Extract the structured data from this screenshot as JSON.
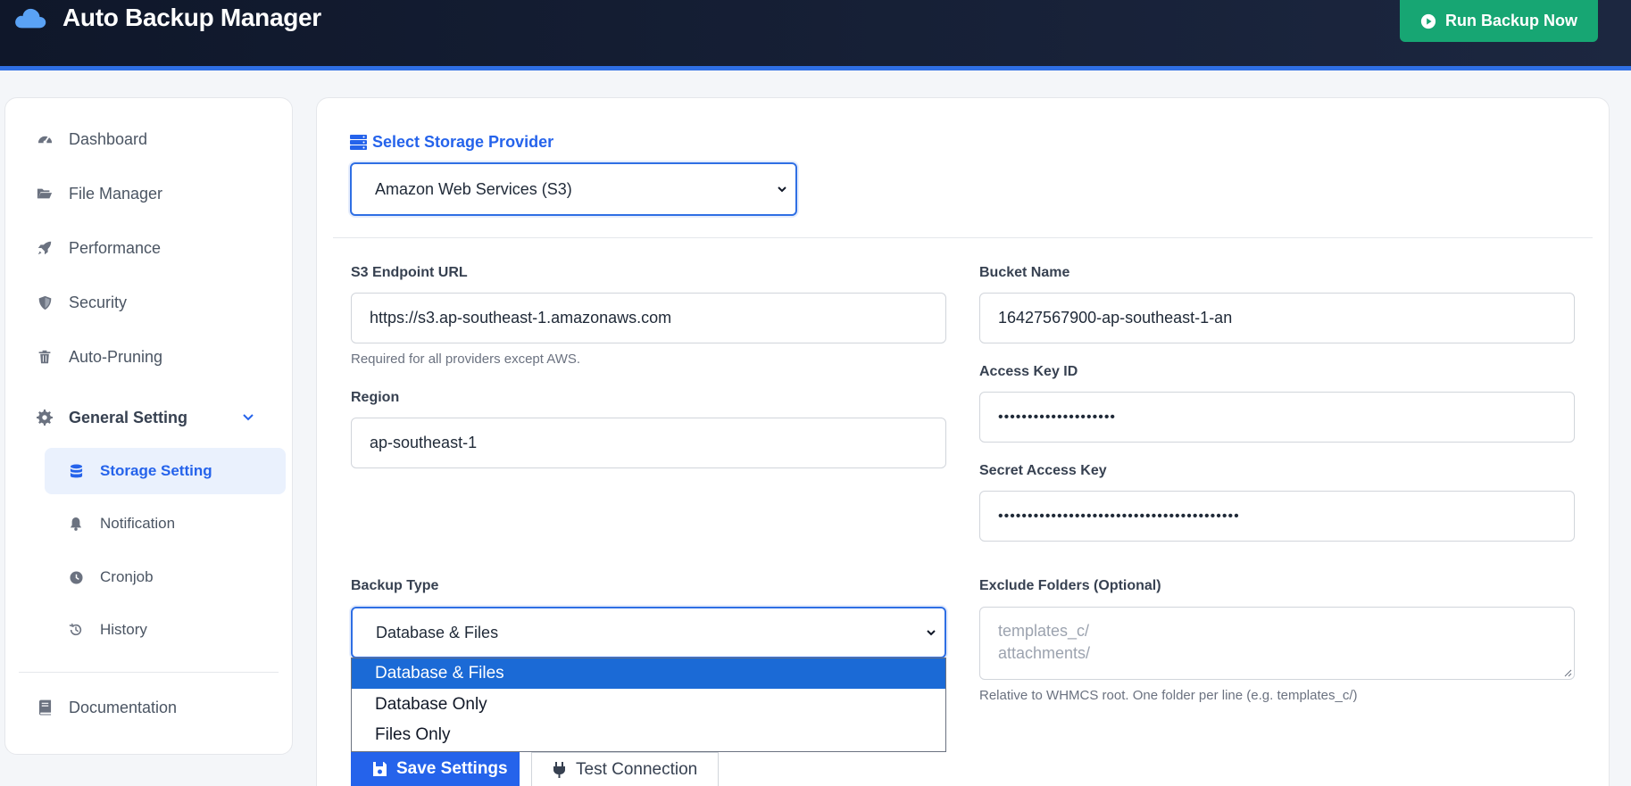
{
  "header": {
    "title": "Auto Backup Manager",
    "run_button": "Run Backup Now",
    "logo_icon": "cloud-icon"
  },
  "sidebar": {
    "items": [
      {
        "label": "Dashboard",
        "icon": "gauge-icon"
      },
      {
        "label": "File Manager",
        "icon": "folder-open-icon"
      },
      {
        "label": "Performance",
        "icon": "rocket-icon"
      },
      {
        "label": "Security",
        "icon": "shield-icon"
      },
      {
        "label": "Auto-Pruning",
        "icon": "trash-icon"
      },
      {
        "label": "General Setting",
        "icon": "gear-icon",
        "expanded": true
      }
    ],
    "subitems": [
      {
        "label": "Storage Setting",
        "icon": "database-icon",
        "active": true
      },
      {
        "label": "Notification",
        "icon": "bell-icon"
      },
      {
        "label": "Cronjob",
        "icon": "clock-icon"
      },
      {
        "label": "History",
        "icon": "history-icon"
      }
    ],
    "footer_item": {
      "label": "Documentation",
      "icon": "book-icon"
    }
  },
  "storage": {
    "section_title": "Select Storage Provider",
    "provider_selected": "Amazon Web Services (S3)",
    "endpoint_label": "S3 Endpoint URL",
    "endpoint_value": "https://s3.ap-southeast-1.amazonaws.com",
    "endpoint_help": "Required for all providers except AWS.",
    "region_label": "Region",
    "region_value": "ap-southeast-1",
    "bucket_label": "Bucket Name",
    "bucket_value": "16427567900-ap-southeast-1-an",
    "access_key_label": "Access Key ID",
    "access_key_value": "••••••••••••••••••••",
    "secret_key_label": "Secret Access Key",
    "secret_key_value": "•••••••••••••••••••••••••••••••••••••••••",
    "backup_type_label": "Backup Type",
    "backup_type_selected": "Database & Files",
    "backup_type_options": [
      "Database & Files",
      "Database Only",
      "Files Only"
    ],
    "exclude_label": "Exclude Folders (Optional)",
    "exclude_placeholder_line1": "templates_c/",
    "exclude_placeholder_line2": "attachments/",
    "exclude_help": "Relative to WHMCS root. One folder per line (e.g. templates_c/)"
  },
  "actions": {
    "save": "Save Settings",
    "test": "Test Connection"
  },
  "colors": {
    "header_bg": "#0f172a",
    "accent": "#2563eb",
    "run_button": "#17a673"
  }
}
